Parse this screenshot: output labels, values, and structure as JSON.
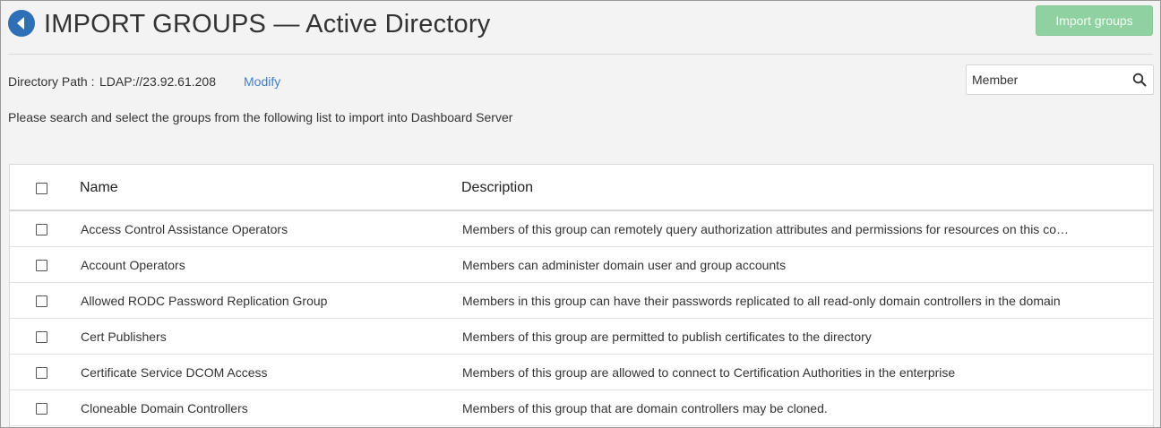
{
  "header": {
    "title": "IMPORT GROUPS — Active Directory",
    "import_button": "Import groups",
    "back_icon": "back-arrow-icon"
  },
  "directory": {
    "label": "Directory Path :",
    "value": "LDAP://23.92.61.208",
    "modify_link": "Modify"
  },
  "search": {
    "value": "Member",
    "icon": "search-icon"
  },
  "instructions": "Please search and select the groups from the following list to import into Dashboard Server",
  "table": {
    "columns": [
      "Name",
      "Description"
    ],
    "rows": [
      {
        "name": "Access Control Assistance Operators",
        "description": "Members of this group can remotely query authorization attributes and permissions for resources on this co…"
      },
      {
        "name": "Account Operators",
        "description": "Members can administer domain user and group accounts"
      },
      {
        "name": "Allowed RODC Password Replication Group",
        "description": "Members in this group can have their passwords replicated to all read-only domain controllers in the domain"
      },
      {
        "name": "Cert Publishers",
        "description": "Members of this group are permitted to publish certificates to the directory"
      },
      {
        "name": "Certificate Service DCOM Access",
        "description": "Members of this group are allowed to connect to Certification Authorities in the enterprise"
      },
      {
        "name": "Cloneable Domain Controllers",
        "description": "Members of this group that are domain controllers may be cloned."
      }
    ]
  },
  "colors": {
    "accent": "#2e6fb6",
    "link": "#3f7fc7",
    "import_button_bg": "#8fd1a0",
    "background": "#f3f3f3"
  }
}
